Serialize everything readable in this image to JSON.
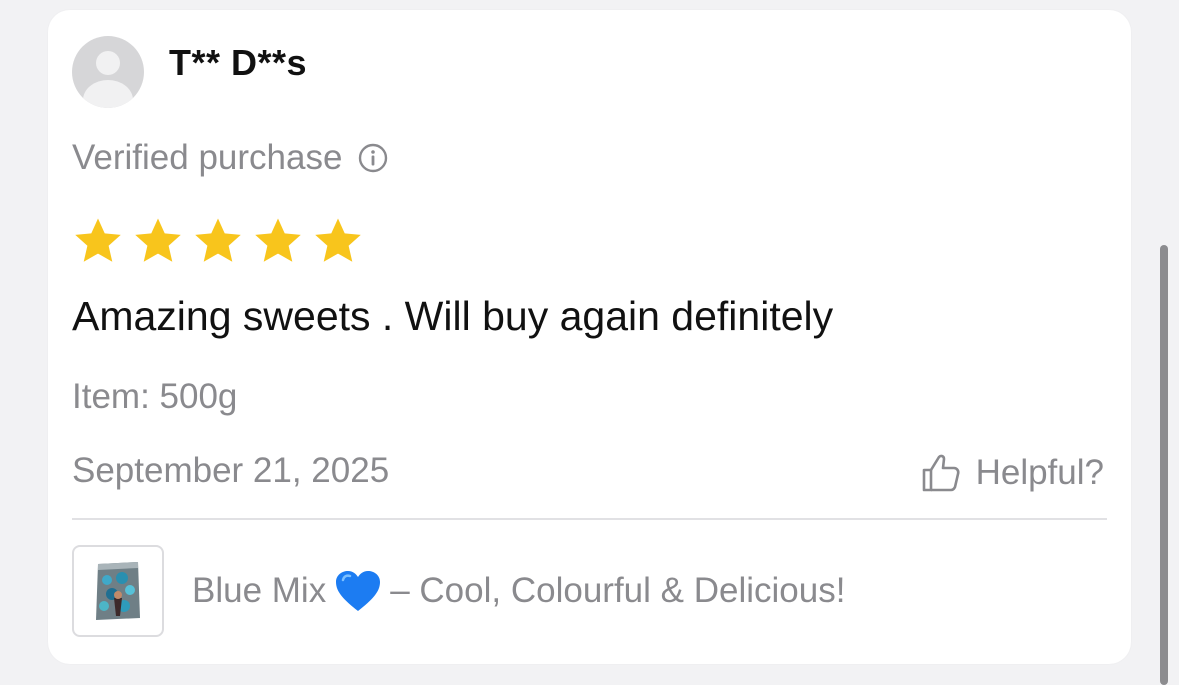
{
  "review": {
    "username": "T** D**s",
    "verified_label": "Verified purchase",
    "rating": 5,
    "rating_max": 5,
    "text": "Amazing sweets . Will buy again definitely",
    "item_label": "Item: 500g",
    "date": "September 21, 2025",
    "helpful_label": "Helpful?"
  },
  "product": {
    "name_before_emoji": "Blue Mix",
    "emoji": "blue-heart",
    "name_after_emoji": "– Cool, Colourful & Delicious!"
  },
  "icons": {
    "info": "info-icon",
    "thumb": "thumbs-up-icon",
    "star": "star-icon"
  },
  "colors": {
    "star": "#f8c51c",
    "muted_text": "#8a8a8e",
    "primary_text": "#111111",
    "heart": "#1c7cf2"
  }
}
